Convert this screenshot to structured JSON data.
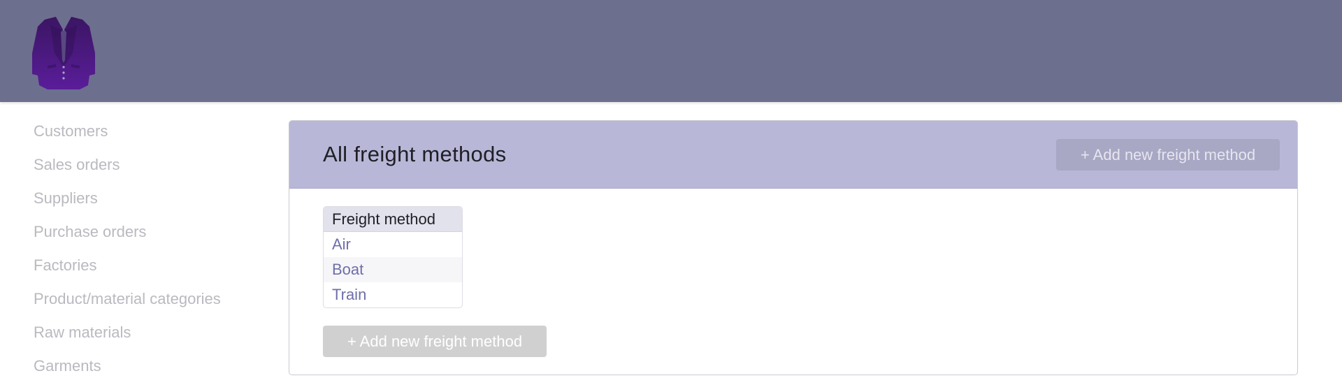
{
  "logo": {
    "icon": "jacket-logo-icon"
  },
  "sidebar": {
    "items": [
      {
        "label": "Customers"
      },
      {
        "label": "Sales orders"
      },
      {
        "label": "Suppliers"
      },
      {
        "label": "Purchase orders"
      },
      {
        "label": "Factories"
      },
      {
        "label": "Product/material categories"
      },
      {
        "label": "Raw materials"
      },
      {
        "label": "Garments"
      }
    ]
  },
  "main": {
    "title": "All freight methods",
    "add_button_label": "+ Add new freight method",
    "table": {
      "columns": [
        "Freight method"
      ],
      "rows": [
        "Air",
        "Boat",
        "Train"
      ]
    },
    "bottom_add_button_label": "+ Add new freight method"
  },
  "colors": {
    "topbar": "#6d6f8e",
    "panel_header": "#b8b7d7",
    "link": "#6f6ea8",
    "sidebar_text": "#b9b9c0",
    "logo_purple": "#4a1c7a"
  }
}
